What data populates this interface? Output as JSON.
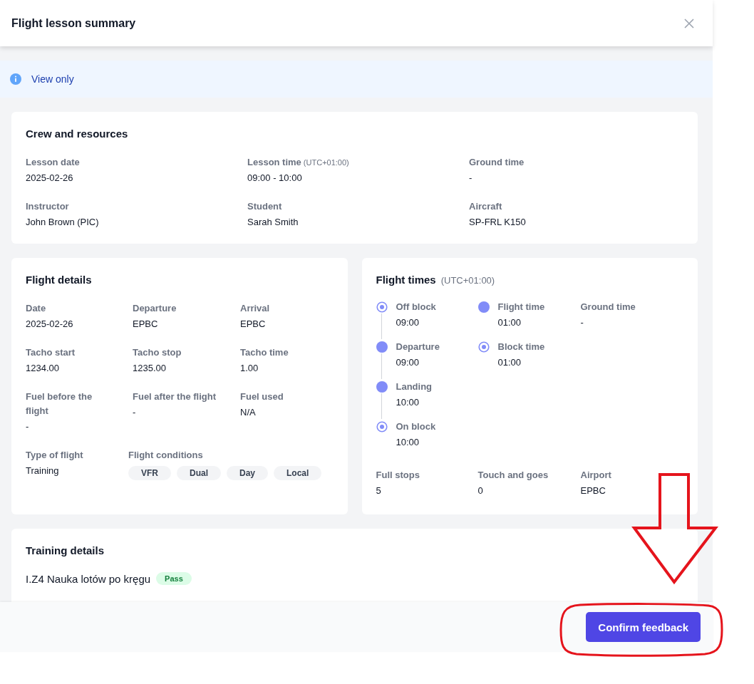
{
  "dialog": {
    "title": "Flight lesson summary"
  },
  "notice": {
    "text": "View only"
  },
  "crew_and_resources": {
    "title": "Crew and resources",
    "fields": [
      {
        "label": "Lesson date",
        "value": "2025-02-26"
      },
      {
        "label": "Lesson time",
        "note": "(UTC+01:00)",
        "value": "09:00 - 10:00"
      },
      {
        "label": "Ground time",
        "value": "-"
      },
      {
        "label": "Instructor",
        "value": "John Brown (PIC)"
      },
      {
        "label": "Student",
        "value": "Sarah Smith"
      },
      {
        "label": "Aircraft",
        "value": "SP-FRL K150"
      }
    ]
  },
  "flight_details": {
    "title": "Flight details",
    "fields": [
      {
        "label": "Date",
        "value": "2025-02-26"
      },
      {
        "label": "Departure",
        "value": "EPBC"
      },
      {
        "label": "Arrival",
        "value": "EPBC"
      },
      {
        "label": "Tacho start",
        "value": "1234.00"
      },
      {
        "label": "Tacho stop",
        "value": "1235.00"
      },
      {
        "label": "Tacho time",
        "value": "1.00"
      },
      {
        "label": "Fuel before the flight",
        "value": "-"
      },
      {
        "label": "Fuel after the flight",
        "value": "-"
      },
      {
        "label": "Fuel used",
        "value": "N/A"
      }
    ],
    "type_of_flight": {
      "label": "Type of flight",
      "value": "Training"
    },
    "flight_conditions": {
      "label": "Flight conditions",
      "tags": [
        "VFR",
        "Dual",
        "Day",
        "Local"
      ]
    }
  },
  "flight_times": {
    "title": "Flight times",
    "note": "(UTC+01:00)",
    "timeline": [
      {
        "kind": "ring",
        "label": "Off block",
        "value": "09:00"
      },
      {
        "kind": "dot",
        "label": "Departure",
        "value": "09:00"
      },
      {
        "kind": "dot",
        "label": "Landing",
        "value": "10:00"
      },
      {
        "kind": "ring",
        "label": "On block",
        "value": "10:00"
      }
    ],
    "durations": [
      {
        "kind": "dot",
        "label": "Flight time",
        "value": "01:00"
      },
      {
        "kind": "ring",
        "label": "Block time",
        "value": "01:00"
      }
    ],
    "ground_time": {
      "label": "Ground time",
      "value": "-"
    },
    "counts": [
      {
        "label": "Full stops",
        "value": "5"
      },
      {
        "label": "Touch and goes",
        "value": "0"
      },
      {
        "label": "Airport",
        "value": "EPBC"
      }
    ]
  },
  "training_details": {
    "title": "Training details",
    "items": [
      {
        "name": "I.Z4 Nauka lotów po kręgu",
        "result": "Pass",
        "kind": "pass"
      }
    ]
  },
  "footer": {
    "buttons": [
      "Confirm feedback"
    ]
  },
  "annotations": [
    {
      "kind": "arrow"
    },
    {
      "kind": "ellipse"
    }
  ]
}
